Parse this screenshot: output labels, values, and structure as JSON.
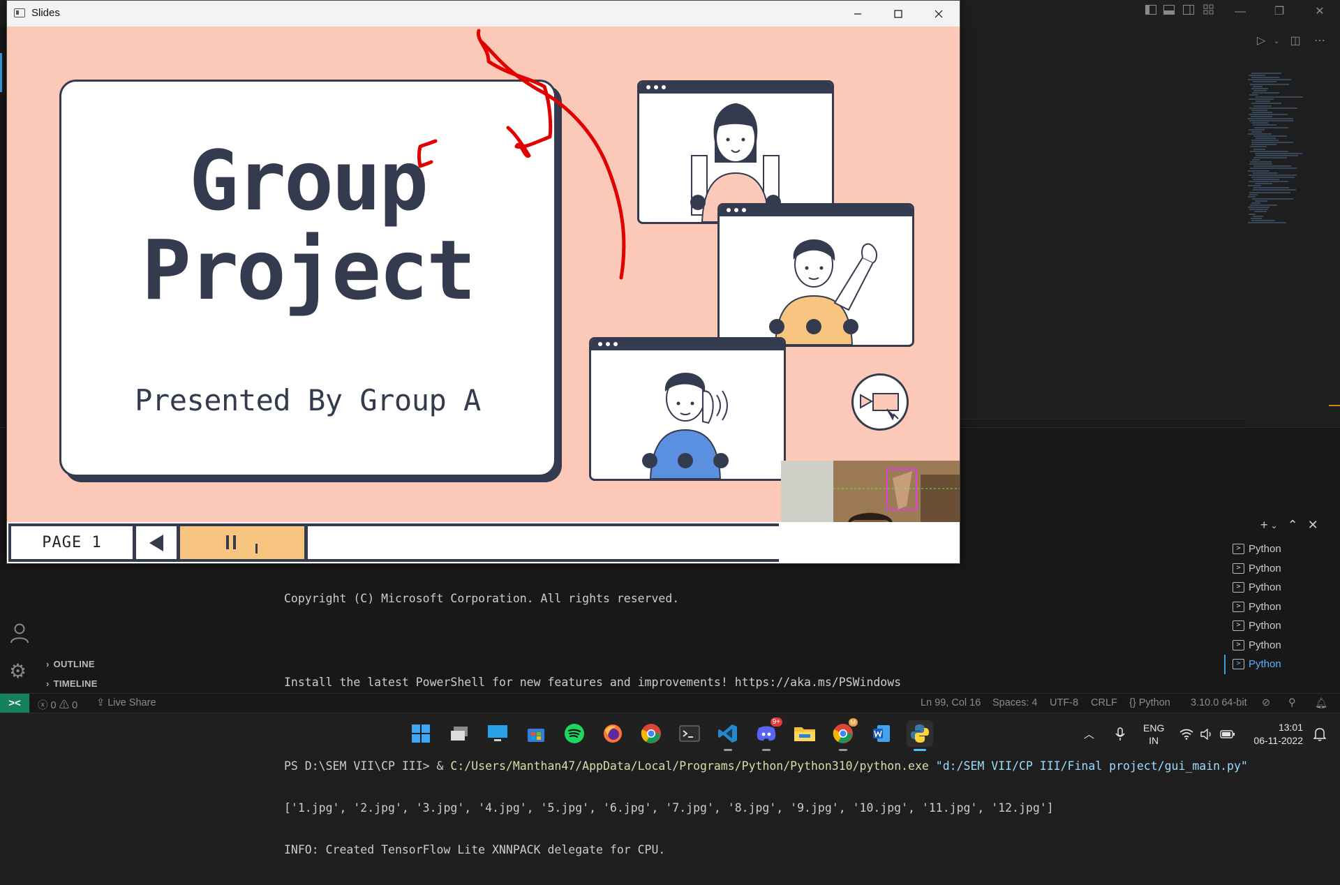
{
  "slides_window": {
    "title": "Slides",
    "slide": {
      "title_line1": "Group",
      "title_line2": "Project",
      "subtitle": "Presented By Group A"
    },
    "controls": {
      "page_label": "PAGE 1",
      "prev_icon": "triangle-left-icon",
      "pause_icon": "pause-icon"
    }
  },
  "vscode": {
    "terminal_lines": [
      "Copyright (C) Microsoft Corporation. All rights reserved.",
      "",
      "Install the latest PowerShell for new features and improvements! https://aka.ms/PSWindows",
      ""
    ],
    "prompt": "PS D:\\SEM VII\\CP III> & ",
    "exe_path": "C:/Users/Manthan47/AppData/Local/Programs/Python/Python310/python.exe",
    "script_path": "\"d:/SEM VII/CP III/Final project/gui_main.py\"",
    "output_line1": "['1.jpg', '2.jpg', '3.jpg', '4.jpg', '5.jpg', '6.jpg', '7.jpg', '8.jpg', '9.jpg', '10.jpg', '11.jpg', '12.jpg']",
    "output_line2": "INFO: Created TensorFlow Lite XNNPACK delegate for CPU.",
    "terminals": [
      "Python",
      "Python",
      "Python",
      "Python",
      "Python",
      "Python",
      "Python"
    ],
    "sidebar_sections": [
      "OUTLINE",
      "TIMELINE"
    ],
    "status": {
      "remote_icon": "remote-icon",
      "errors": "0",
      "warnings": "0",
      "live_share": "Live Share",
      "position": "Ln 99, Col 16",
      "spaces": "Spaces: 4",
      "encoding": "UTF-8",
      "eol": "CRLF",
      "language": "Python",
      "interpreter": "3.10.0 64-bit"
    }
  },
  "taskbar": {
    "lang_top": "ENG",
    "lang_bottom": "IN",
    "time": "13:01",
    "date": "06-11-2022",
    "discord_badge": "9+",
    "chrome_badge": "M"
  }
}
